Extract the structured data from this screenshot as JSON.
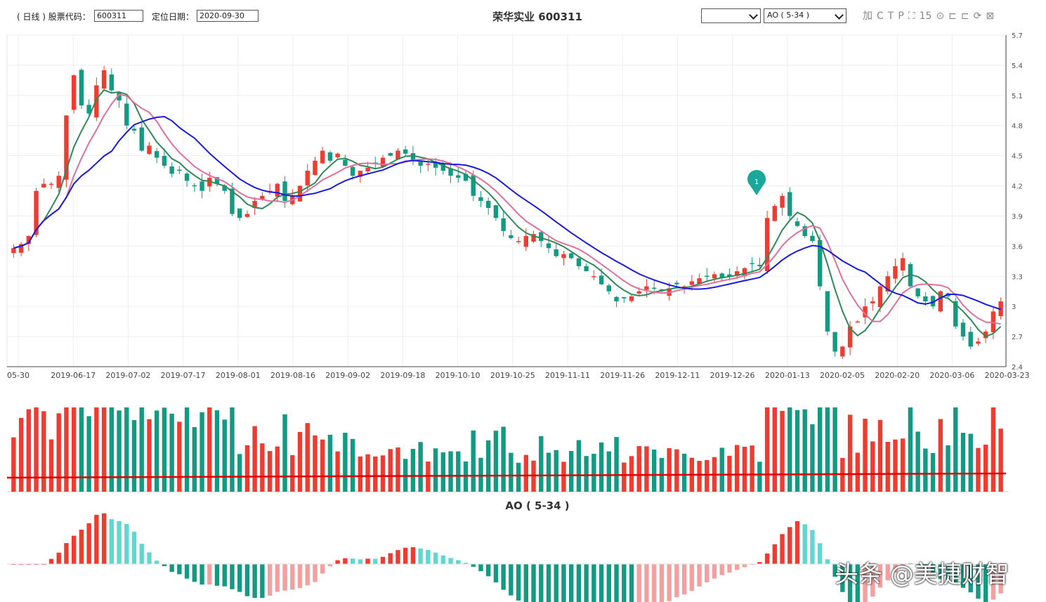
{
  "toolbar": {
    "period_label": "( 日线 ) 股票代码：",
    "code_value": "600311",
    "date_label": "定位日期：",
    "date_value": "2020-09-30",
    "title": "荣华实业 600311",
    "select1_value": "",
    "select2_value": "AO ( 5-34 )",
    "tool_icons": [
      "加",
      "C",
      "T",
      "P",
      "⛶",
      "15",
      "⊙",
      "⊏",
      "⊏",
      "⟳",
      "⊠"
    ]
  },
  "indicator_title": "AO ( 5-34 )",
  "watermark": "头条 @美捷财智",
  "marker_label": "1",
  "colors": {
    "up": "#f03b30",
    "down": "#129b82",
    "ma_blue": "#1a1ae0",
    "ma_green": "#2e8b57",
    "ma_pink": "#e0709a",
    "ao_up": "#f5a0a0",
    "ao_down": "#60d8d0"
  },
  "chart_data": {
    "type": "candlestick",
    "x_tick_labels": [
      "05-30",
      "2019-06-17",
      "2019-07-02",
      "2019-07-17",
      "2019-08-01",
      "2019-08-16",
      "2019-09-02",
      "2019-09-18",
      "2019-10-10",
      "2019-10-25",
      "2019-11-11",
      "2019-11-26",
      "2019-12-11",
      "2019-12-26",
      "2020-01-13",
      "2020-02-05",
      "2020-02-20",
      "2020-03-06",
      "2020-03-23"
    ],
    "y_tick_labels": [
      "5.7",
      "5.4",
      "5.1",
      "4.8",
      "4.5",
      "4.2",
      "3.9",
      "3.6",
      "3.3",
      "3",
      "2.7",
      "2.4"
    ],
    "ylim": [
      2.4,
      5.7
    ],
    "close_path": [
      3.58,
      3.62,
      3.7,
      4.15,
      4.22,
      4.22,
      4.3,
      4.9,
      5.3,
      5.0,
      4.92,
      5.2,
      5.35,
      5.15,
      5.05,
      4.8,
      4.75,
      4.55,
      4.6,
      4.48,
      4.4,
      4.32,
      4.35,
      4.25,
      4.2,
      4.15,
      4.28,
      4.22,
      4.15,
      3.92,
      3.88,
      3.92,
      4.05,
      4.1,
      4.15,
      4.22,
      4.05,
      4.1,
      4.2,
      4.35,
      4.45,
      4.55,
      4.45,
      4.52,
      4.4,
      4.3,
      4.35,
      4.38,
      4.42,
      4.48,
      4.5,
      4.55,
      4.52,
      4.45,
      4.4,
      4.42,
      4.38,
      4.35,
      4.3,
      4.28,
      4.25,
      4.1,
      4.05,
      3.98,
      3.88,
      3.75,
      3.68,
      3.65,
      3.7,
      3.72,
      3.65,
      3.58,
      3.5,
      3.52,
      3.48,
      3.4,
      3.35,
      3.3,
      3.22,
      3.15,
      3.05,
      3.08,
      3.1,
      3.15,
      3.2,
      3.18,
      3.15,
      3.18,
      3.22,
      3.2,
      3.25,
      3.28,
      3.3,
      3.32,
      3.28,
      3.3,
      3.35,
      3.38,
      3.42,
      3.4,
      3.88,
      4.0,
      4.1,
      3.9,
      3.8,
      3.7,
      3.65,
      3.2,
      2.75,
      2.55,
      2.6,
      2.8,
      2.85,
      3.0,
      3.05,
      3.2,
      3.3,
      3.4,
      3.48,
      3.2,
      3.1,
      3.05,
      3.0,
      3.15,
      3.1,
      2.8,
      2.7,
      2.6,
      2.65,
      2.75,
      2.95,
      3.05
    ]
  }
}
